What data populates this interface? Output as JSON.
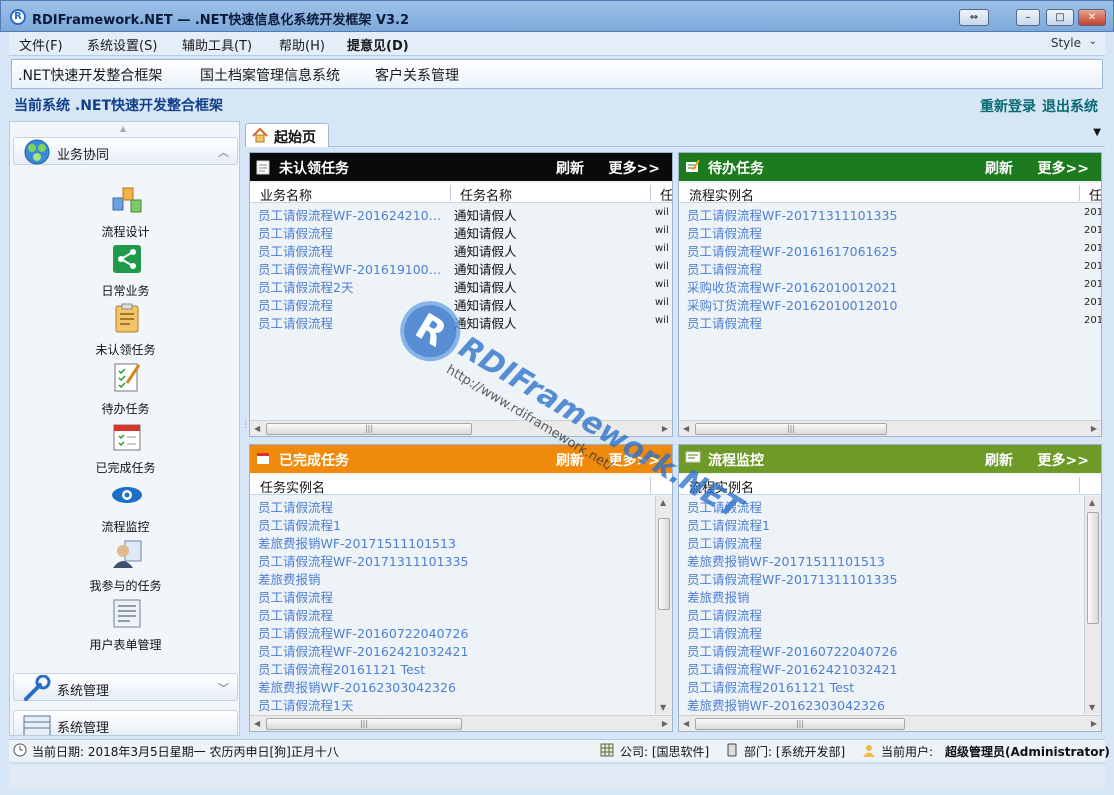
{
  "window": {
    "title": "RDIFramework.NET — .NET快速信息化系统开发框架 V3.2",
    "logo_letter": "R",
    "buttons": {
      "restore": "⇔",
      "minimize": "–",
      "maximize": "□",
      "close": "✕"
    }
  },
  "menu": {
    "items": [
      "文件(F)",
      "系统设置(S)",
      "辅助工具(T)",
      "帮助(H)",
      "提意见(D)"
    ],
    "style_label": "Style",
    "style_arrow": "⌄"
  },
  "systems": {
    "items": [
      ".NET快速开发整合框架",
      "国土档案管理信息系统",
      "客户关系管理"
    ]
  },
  "current_system": {
    "text": "当前系统 .NET快速开发整合框架",
    "relogin": "重新登录",
    "logout": "退出系统"
  },
  "sidebar": {
    "scroll_up": "▲",
    "group1": {
      "label": "业务协同",
      "chevron": "︿",
      "icon": "people-group-icon"
    },
    "items": [
      {
        "label": "流程设计",
        "icon": "workflow-design-icon"
      },
      {
        "label": "日常业务",
        "icon": "share-icon"
      },
      {
        "label": "未认领任务",
        "icon": "clipboard-icon"
      },
      {
        "label": "待办任务",
        "icon": "checklist-pen-icon"
      },
      {
        "label": "已完成任务",
        "icon": "calendar-check-icon"
      },
      {
        "label": "流程监控",
        "icon": "eye-icon"
      },
      {
        "label": "我参与的任务",
        "icon": "user-document-icon"
      },
      {
        "label": "用户表单管理",
        "icon": "form-icon"
      }
    ],
    "group2": {
      "label": "系统管理",
      "chevron": "﹀",
      "icon": "wrench-icon"
    },
    "group3": {
      "label": "系统管理",
      "icon": "table-icon"
    }
  },
  "tabs": {
    "home_label": "起始页",
    "dropdown": "▼"
  },
  "panels": {
    "unclaimed": {
      "title": "未认领任务",
      "refresh": "刷新",
      "more": "更多>>",
      "color": "#0a0a0a",
      "columns": [
        "业务名称",
        "任务名称",
        "任"
      ],
      "rows": [
        [
          "员工请假流程WF-201624210…",
          "通知请假人",
          "wil"
        ],
        [
          "员工请假流程",
          "通知请假人",
          "wil"
        ],
        [
          "员工请假流程",
          "通知请假人",
          "wil"
        ],
        [
          "员工请假流程WF-201619100…",
          "通知请假人",
          "wil"
        ],
        [
          "员工请假流程2天",
          "通知请假人",
          "wil"
        ],
        [
          "员工请假流程",
          "通知请假人",
          "wil"
        ],
        [
          "员工请假流程",
          "通知请假人",
          "wil"
        ]
      ]
    },
    "todo": {
      "title": "待办任务",
      "refresh": "刷新",
      "more": "更多>>",
      "color": "#1e7a1e",
      "columns": [
        "流程实例名",
        "任"
      ],
      "rows": [
        [
          "员工请假流程WF-20171311101335",
          "201"
        ],
        [
          "员工请假流程",
          "201"
        ],
        [
          "员工请假流程WF-20161617061625",
          "201"
        ],
        [
          "员工请假流程",
          "201"
        ],
        [
          "采购收货流程WF-20162010012021",
          "201"
        ],
        [
          "采购订货流程WF-20162010012010",
          "201"
        ],
        [
          "员工请假流程",
          "201"
        ]
      ]
    },
    "completed": {
      "title": "已完成任务",
      "refresh": "刷新",
      "more": "更多>>",
      "color": "#f08a0c",
      "columns": [
        "任务实例名"
      ],
      "rows": [
        "员工请假流程",
        "员工请假流程1",
        "差旅费报销WF-20171511101513",
        "员工请假流程WF-20171311101335",
        "差旅费报销",
        "员工请假流程",
        "员工请假流程",
        "员工请假流程WF-20160722040726",
        "员工请假流程WF-20162421032421",
        "员工请假流程20161121 Test",
        "差旅费报销WF-20162303042326",
        "员工请假流程1天"
      ]
    },
    "monitor": {
      "title": "流程监控",
      "refresh": "刷新",
      "more": "更多>>",
      "color": "#6e9a28",
      "columns": [
        "流程实例名"
      ],
      "rows": [
        "员工请假流程",
        "员工请假流程1",
        "员工请假流程",
        "差旅费报销WF-20171511101513",
        "员工请假流程WF-20171311101335",
        "差旅费报销",
        "员工请假流程",
        "员工请假流程",
        "员工请假流程WF-20160722040726",
        "员工请假流程WF-20162421032421",
        "员工请假流程20161121 Test",
        "差旅费报销WF-20162303042326"
      ]
    }
  },
  "watermark": {
    "logo": "R",
    "name": "RDIFramework.NET",
    "url": "http://www.rdiframework.net/"
  },
  "status": {
    "date": "当前日期: 2018年3月5日星期一 农历丙申日[狗]正月十八",
    "company": "公司: [国思软件]",
    "department": "部门: [系统开发部]",
    "user_label": "当前用户:",
    "user_value": "超级管理员(Administrator)"
  }
}
